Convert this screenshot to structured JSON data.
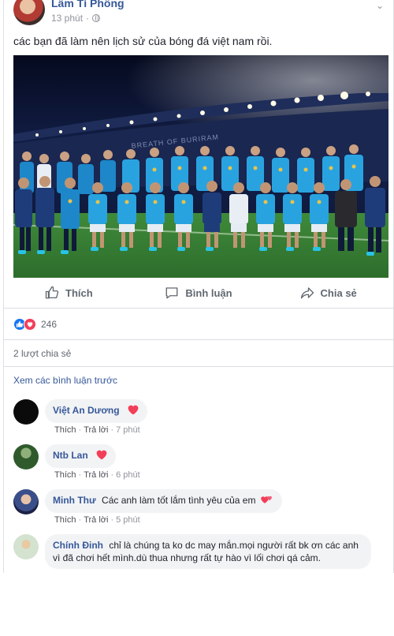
{
  "post": {
    "author": "Lâm Tí Phông",
    "time": "13 phút",
    "text": "các bạn đã làm nên lịch sử của bóng đá việt nam rồi.",
    "photo_banner": "BREATH OF BURIRAM"
  },
  "actions": {
    "like_label": "Thích",
    "comment_label": "Bình luận",
    "share_label": "Chia sẻ"
  },
  "reactions": {
    "count": "246",
    "icons": [
      "like-icon",
      "love-icon"
    ],
    "like_color": "#1877f2",
    "love_color": "#f33e58"
  },
  "shares": "2 lượt chia sẻ",
  "view_previous": "Xem các bình luận trước",
  "comments": [
    {
      "name": "Việt An Dương",
      "text": "",
      "reaction": "heart",
      "like_label": "Thích",
      "reply_label": "Trả lời",
      "time": "7 phút"
    },
    {
      "name": "Ntb Lan",
      "text": "",
      "reaction": "heart",
      "like_label": "Thích",
      "reply_label": "Trả lời",
      "time": "6 phút"
    },
    {
      "name": "Minh Thư",
      "text": "Các anh làm tốt lắm tình yêu của em",
      "reaction": "heart",
      "like_label": "Thích",
      "reply_label": "Trả lời",
      "time": "5 phút"
    },
    {
      "name": "Chính Đinh",
      "text": "chỉ là chúng ta ko dc may mắn.mọi người rất bk ơn các anh vì đã chơi hết mình.dù thua nhưng rất tự hào vì lối chơi qá cảm."
    }
  ],
  "colors": {
    "link": "#365899",
    "muted": "#90949c",
    "bubble": "#f2f3f5",
    "heart": "#f33e58"
  }
}
